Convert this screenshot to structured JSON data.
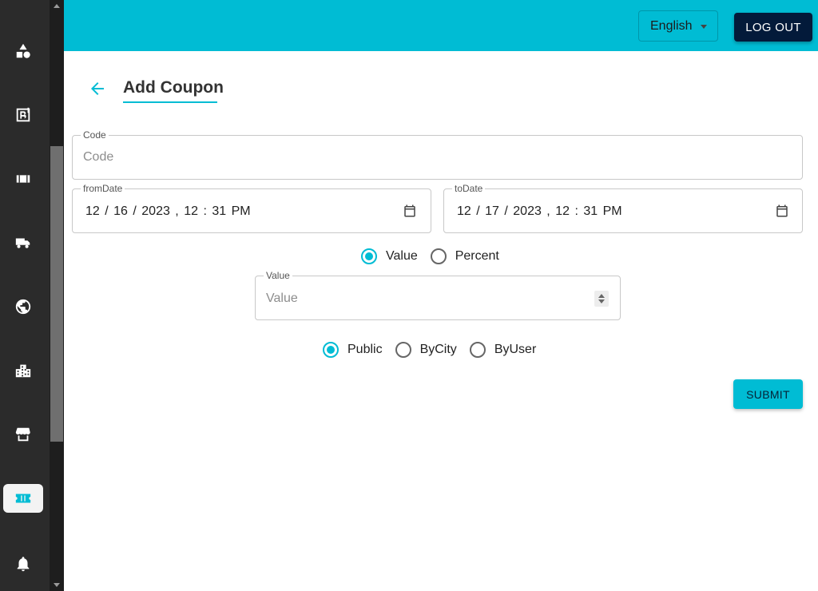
{
  "sidebar": {
    "items": [
      {
        "icon": "shapes-icon"
      },
      {
        "icon": "brand-icon"
      },
      {
        "icon": "ticket-icon"
      },
      {
        "icon": "delivery-truck-icon"
      },
      {
        "icon": "globe-icon"
      },
      {
        "icon": "city-icon"
      },
      {
        "icon": "store-icon"
      },
      {
        "icon": "coupon-icon",
        "active": true
      },
      {
        "icon": "bell-icon"
      }
    ]
  },
  "header": {
    "language": "English",
    "logout_label": "LOG OUT"
  },
  "page": {
    "title": "Add Coupon"
  },
  "form": {
    "code": {
      "label": "Code",
      "placeholder": "Code",
      "value": ""
    },
    "from_date": {
      "label": "fromDate",
      "value": "12 / 16 / 2023 ,  12 : 31   PM"
    },
    "to_date": {
      "label": "toDate",
      "value": "12 / 17 / 2023 ,  12 : 31   PM"
    },
    "discount_type": {
      "options": [
        "Value",
        "Percent"
      ],
      "selected": "Value"
    },
    "value": {
      "label": "Value",
      "placeholder": "Value"
    },
    "scope": {
      "options": [
        "Public",
        "ByCity",
        "ByUser"
      ],
      "selected": "Public"
    },
    "submit_label": "SUBMIT"
  },
  "colors": {
    "accent": "#00bcd4",
    "dark": "#031a3a",
    "sidebar": "#2b2b2b"
  }
}
